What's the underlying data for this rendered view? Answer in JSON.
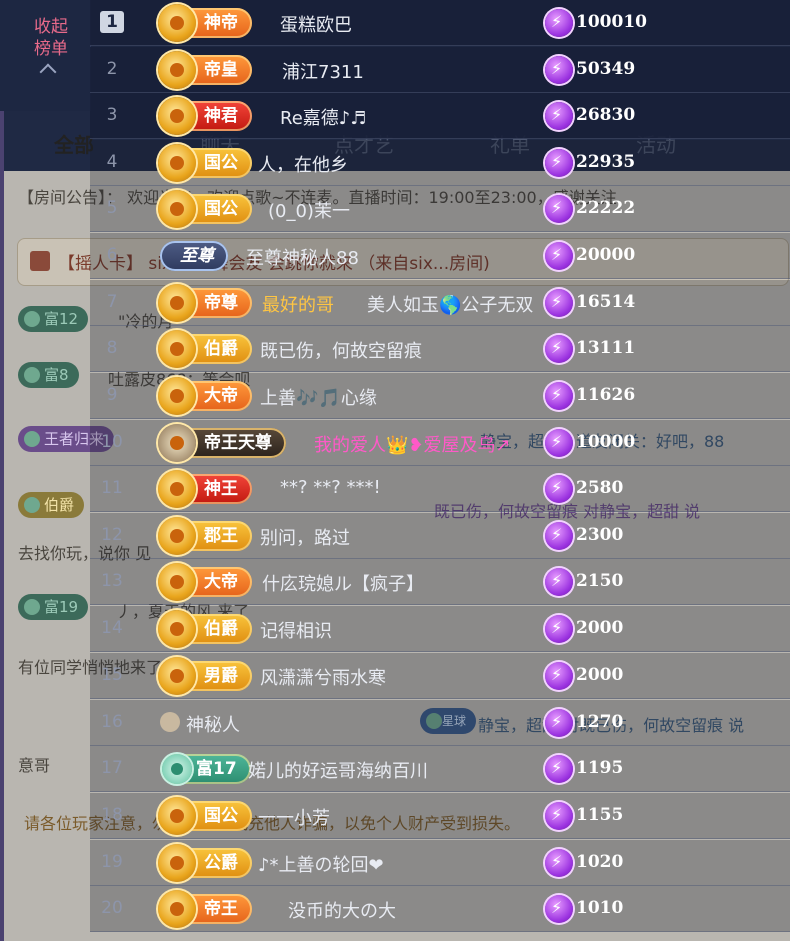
{
  "panel": {
    "collapse_label": "收起榜单"
  },
  "background": {
    "tabs": [
      "全部",
      "聊天",
      "点才艺",
      "礼单",
      "活动"
    ],
    "announcement": "【房间公告】：     欢迎光临，欢迎点歌~不连麦。直播时间：19:00至23:00，感谢关注.",
    "banner": "【摇人卡】                              six说 以舞会友 会跳你就来    （来自six...房间)",
    "chat_lines": [
      "\"冷的月",
      "吐露皮868：等会呗",
      "静宝，超甜，道友闭关：好吧，88",
      "既已伤，何故空留痕   对静宝，超甜 说",
      "去找你玩，说你           见",
      "丿，夏天的风 来了",
      "有位同学悄悄地来了",
      "静宝，超甜 对既已伤，何故空留痕 说",
      "意哥"
    ],
    "badges": [
      "富12",
      "富8",
      "富19",
      "王者归来",
      "伯爵",
      "小星球"
    ],
    "notice": "请各位玩家注意，勿相信任何代充他人诈骗，以免个人财产受到损失。"
  },
  "rows": [
    {
      "rank": "1",
      "badge": "神帝",
      "name": "蛋糕欧巴",
      "score": "100010"
    },
    {
      "rank": "2",
      "badge": "帝皇",
      "name": "浦江7311",
      "score": "50349"
    },
    {
      "rank": "3",
      "badge": "神君",
      "name": "Re嘉德♪♬",
      "score": "26830"
    },
    {
      "rank": "4",
      "badge": "国公",
      "name": "人，在他乡",
      "score": "22935"
    },
    {
      "rank": "5",
      "badge": "国公",
      "name": "(0_0)茉一",
      "score": "22222"
    },
    {
      "rank": "6",
      "badge": "至尊",
      "name": "至尊神秘人88",
      "score": "20000"
    },
    {
      "rank": "7",
      "badge": "帝尊",
      "name": "最好的哥",
      "name_extra": "美人如玉🌎公子无双",
      "score": "16514"
    },
    {
      "rank": "8",
      "badge": "伯爵",
      "name": "既已伤，何故空留痕",
      "score": "13111"
    },
    {
      "rank": "9",
      "badge": "大帝",
      "name": "上善🎶🎵心缘",
      "score": "11626"
    },
    {
      "rank": "10",
      "badge": "帝王天尊",
      "name": "我的爱人👑❥爱屋及乌↗",
      "score": "10000"
    },
    {
      "rank": "11",
      "badge": "神王",
      "name": "**?  **?  ***!",
      "score": "2580"
    },
    {
      "rank": "12",
      "badge": "郡王",
      "name": "别问，路过",
      "score": "2300"
    },
    {
      "rank": "13",
      "badge": "大帝",
      "name": "什庅琓媳ル【疯子】",
      "score": "2150"
    },
    {
      "rank": "14",
      "badge": "伯爵",
      "name": "记得相识",
      "score": "2000"
    },
    {
      "rank": "15",
      "badge": "男爵",
      "name": "风潇潇兮雨水寒",
      "score": "2000"
    },
    {
      "rank": "16",
      "badge": "",
      "name": "神秘人",
      "score": "1270"
    },
    {
      "rank": "17",
      "badge": "富17",
      "name": "婼儿的好运哥海纳百川",
      "score": "1195"
    },
    {
      "rank": "18",
      "badge": "国公",
      "name": "一一小芳",
      "score": "1155"
    },
    {
      "rank": "19",
      "badge": "公爵",
      "name": "♪*上善の轮回❤",
      "score": "1020"
    },
    {
      "rank": "20",
      "badge": "帝王",
      "name": "没币的大の大",
      "score": "1010"
    }
  ]
}
